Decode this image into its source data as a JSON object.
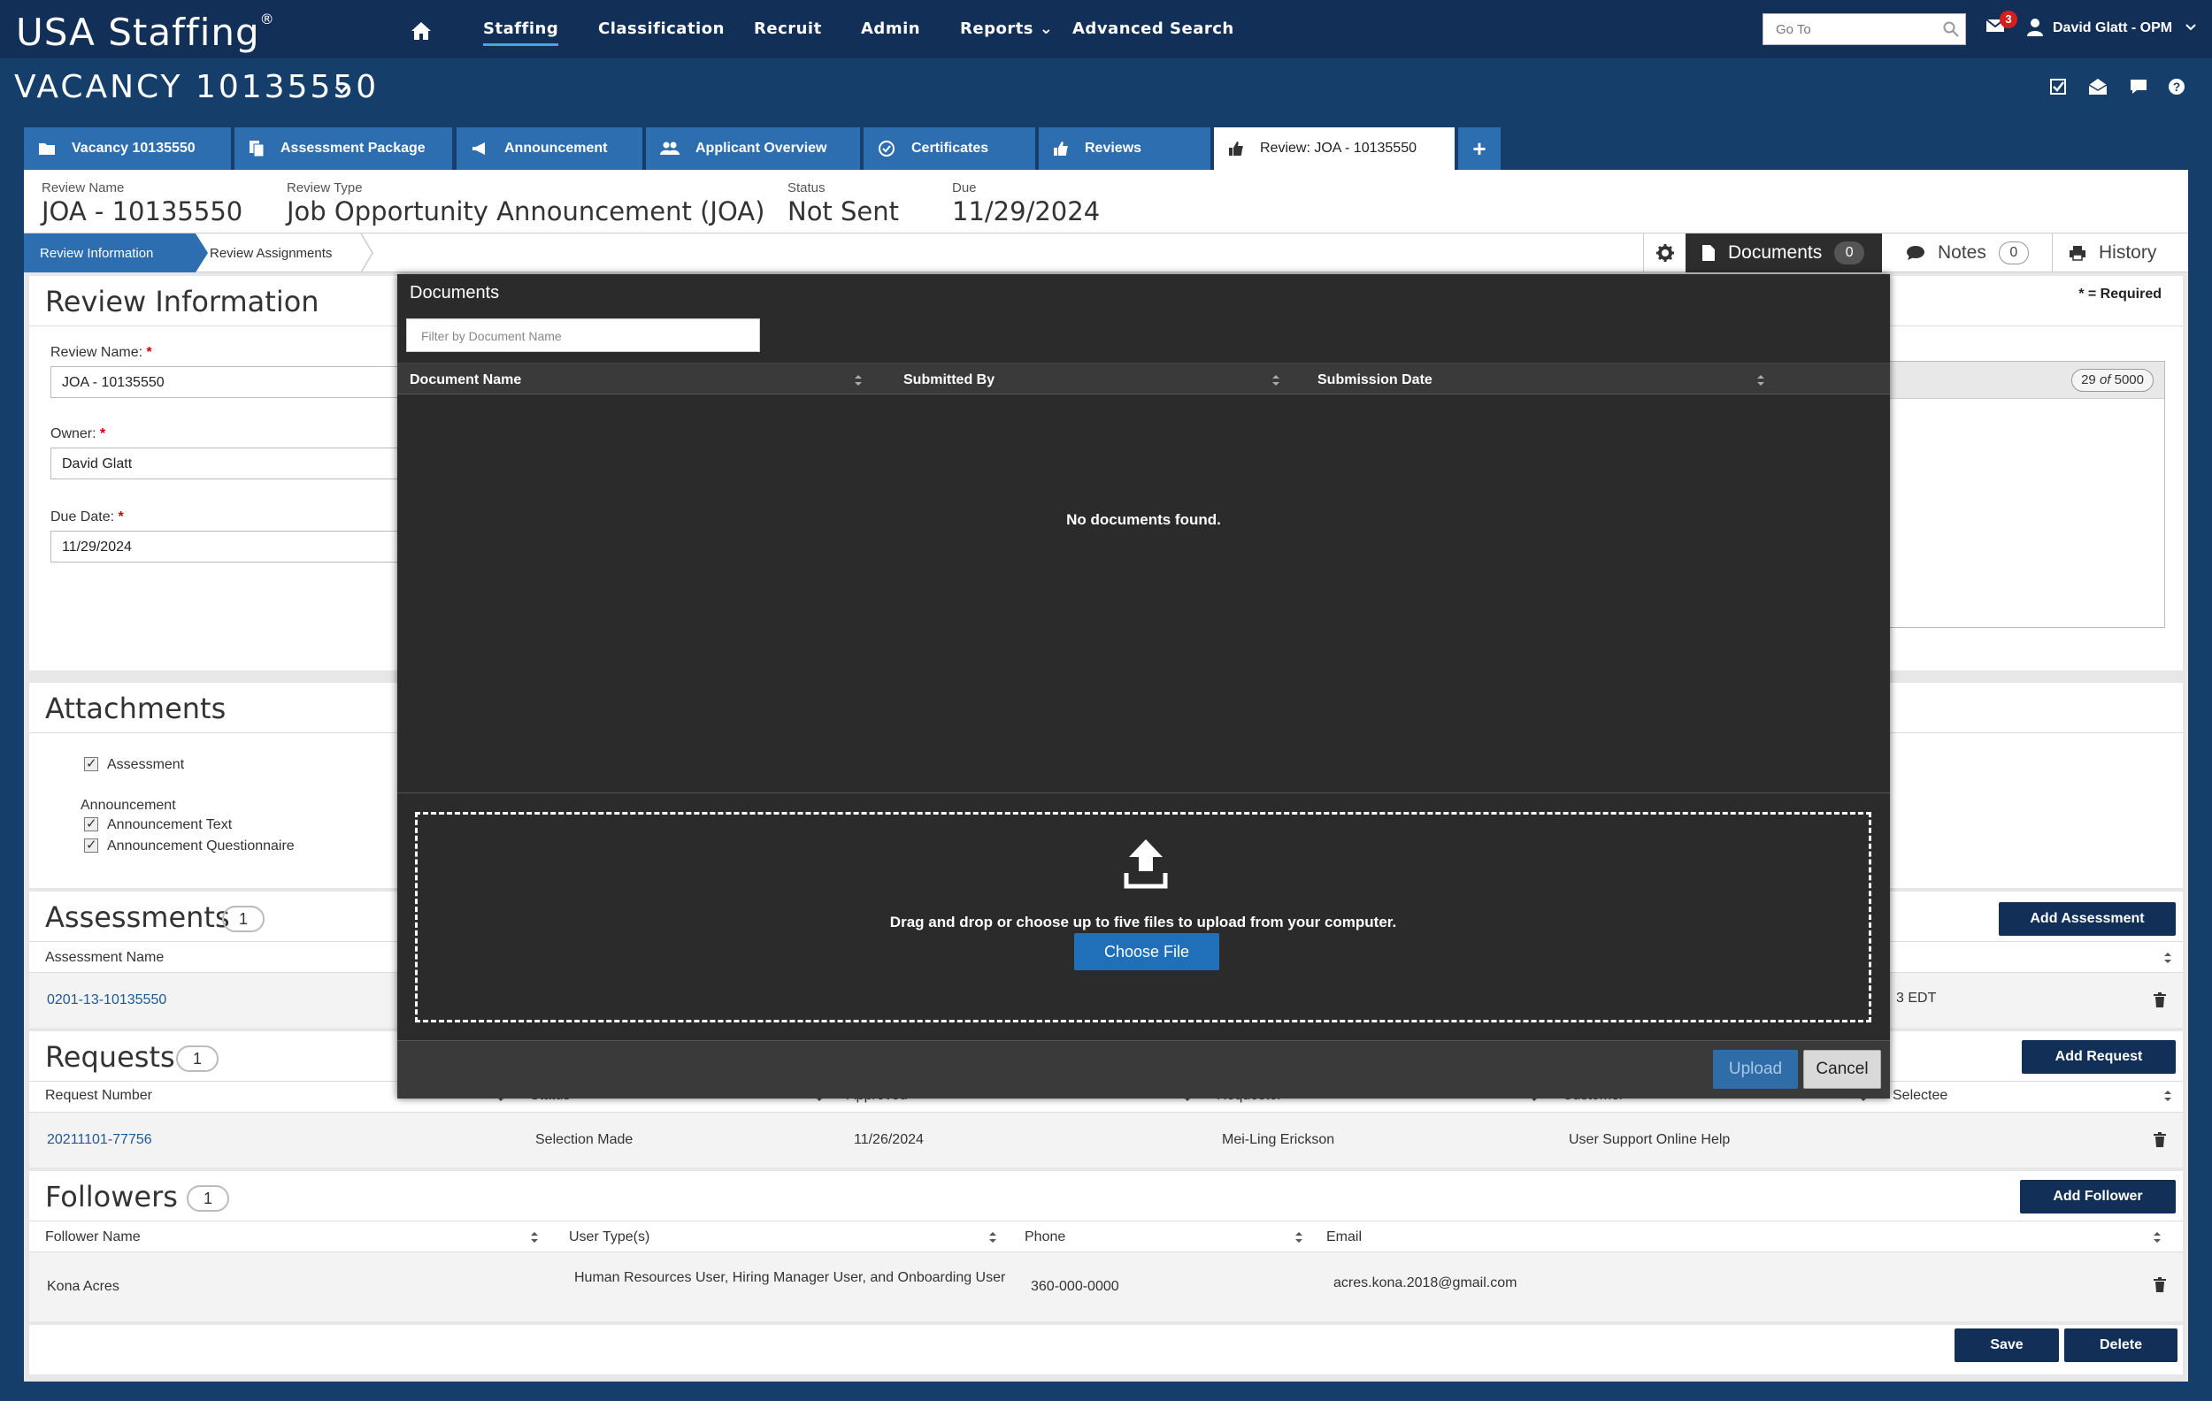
{
  "app": {
    "logo": "USA Staffing",
    "logo_mark": "®"
  },
  "nav": {
    "items": [
      "Staffing",
      "Classification",
      "Recruit",
      "Admin",
      "Reports",
      "Advanced Search"
    ],
    "goto_placeholder": "Go To",
    "mail_count": "3",
    "user": "David Glatt - OPM"
  },
  "vacancy": {
    "title": "VACANCY 10135550"
  },
  "tabs": [
    {
      "label": "Vacancy 10135550",
      "icon": "folder-icon"
    },
    {
      "label": "Assessment Package",
      "icon": "documents-icon"
    },
    {
      "label": "Announcement",
      "icon": "megaphone-icon"
    },
    {
      "label": "Applicant Overview",
      "icon": "people-icon"
    },
    {
      "label": "Certificates",
      "icon": "check-circle-icon"
    },
    {
      "label": "Reviews",
      "icon": "thumbs-up-icon"
    },
    {
      "label": "Review: JOA - 10135550",
      "icon": "thumbs-up-icon"
    },
    {
      "label": "+",
      "icon": "plus-icon"
    }
  ],
  "summary": {
    "review_name_label": "Review Name",
    "review_name": "JOA - 10135550",
    "review_type_label": "Review Type",
    "review_type": "Job Opportunity Announcement (JOA)",
    "status_label": "Status",
    "status": "Not Sent",
    "due_label": "Due",
    "due": "11/29/2024"
  },
  "subtabs": {
    "info": "Review Information",
    "assignments": "Review Assignments"
  },
  "side_tabs": {
    "documents": "Documents",
    "documents_count": "0",
    "notes": "Notes",
    "notes_count": "0",
    "history": "History"
  },
  "review_info": {
    "title": "Review Information",
    "required_note": "* = Required",
    "name_label": "Review Name:",
    "name_value": "JOA - 10135550",
    "owner_label": "Owner:",
    "owner_value": "David Glatt",
    "due_label": "Due Date:",
    "due_value": "11/29/2024",
    "char_count": "29",
    "char_of": "of",
    "char_max": "5000"
  },
  "attachments": {
    "title": "Attachments",
    "assessment": "Assessment",
    "announcement_heading": "Announcement",
    "announcement_text": "Announcement Text",
    "announcement_questionnaire": "Announcement Questionnaire"
  },
  "assessments": {
    "title": "Assessments",
    "count": "1",
    "add_label": "Add Assessment",
    "col_name": "Assessment Name",
    "rows": [
      {
        "name": "0201-13-10135550",
        "date_tail": "3 EDT"
      }
    ]
  },
  "requests": {
    "title": "Requests",
    "count": "1",
    "add_label": "Add Request",
    "columns": [
      "Request Number",
      "Status",
      "Approved",
      "Requester",
      "Customer",
      "Selectee"
    ],
    "rows": [
      {
        "number": "20211101-77756",
        "status": "Selection Made",
        "approved": "11/26/2024",
        "requester": "Mei-Ling Erickson",
        "customer": "User Support Online Help"
      }
    ]
  },
  "followers": {
    "title": "Followers",
    "count": "1",
    "add_label": "Add Follower",
    "columns": [
      "Follower Name",
      "User Type(s)",
      "Phone",
      "Email"
    ],
    "rows": [
      {
        "name": "Kona Acres",
        "types": "Human Resources User, Hiring Manager User, and Onboarding User",
        "phone": "360-000-0000",
        "email": "acres.kona.2018@gmail.com"
      }
    ]
  },
  "footer": {
    "save": "Save",
    "delete": "Delete"
  },
  "modal": {
    "title": "Documents",
    "filter_placeholder": "Filter by Document Name",
    "columns": [
      "Document Name",
      "Submitted By",
      "Submission Date"
    ],
    "empty": "No documents found.",
    "drop_text": "Drag and drop or choose up to five files to upload from your computer.",
    "choose_file": "Choose File",
    "upload": "Upload",
    "cancel": "Cancel"
  },
  "colors": {
    "nav_bg": "#122f57",
    "tab_bg": "#2d6eb0",
    "modal_bg": "#2b2b2b",
    "primary_button": "#1f70b8",
    "dark_button": "#122f57"
  }
}
